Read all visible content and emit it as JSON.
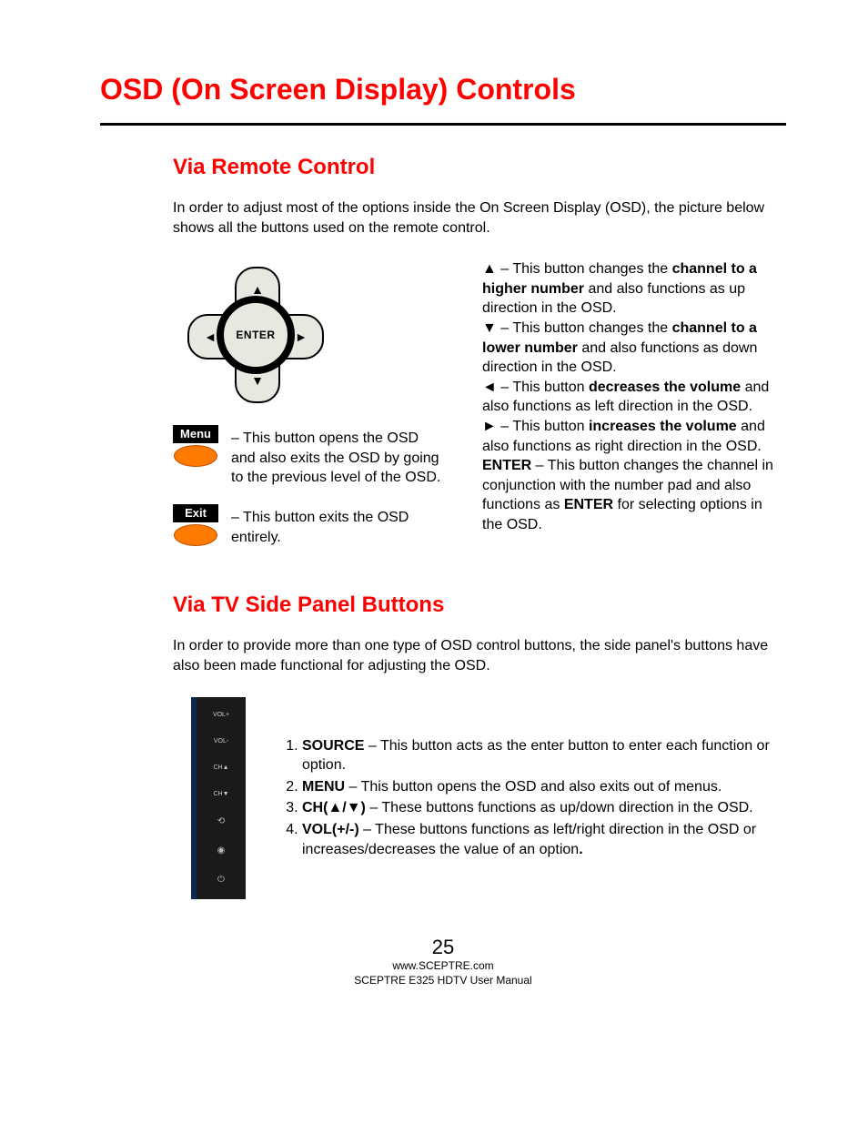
{
  "title": "OSD (On Screen Display) Controls",
  "section1": {
    "heading": "Via Remote Control",
    "intro": "In order to adjust most of the options inside the On Screen Display (OSD), the picture below shows all the buttons used on the remote control.",
    "dpad_enter": "ENTER",
    "menu_label": "Menu",
    "menu_desc": " – This button opens the OSD and also exits the OSD by going to the previous level of the OSD.",
    "exit_label": "Exit",
    "exit_desc": " – This button exits the OSD entirely.",
    "up_sym": "▲",
    "up_a": " – This button changes the ",
    "up_b": "channel to a higher number",
    "up_c": " and also functions as up direction in the OSD.",
    "down_sym": "▼",
    "down_a": " – This button changes the ",
    "down_b": "channel to a lower number",
    "down_c": " and also functions as down direction in the OSD.",
    "left_sym": "◄",
    "left_a": " – This button ",
    "left_b": "decreases the volume",
    "left_c": " and also functions as left direction in the OSD.",
    "right_sym": "►",
    "right_a": " – This button ",
    "right_b": "increases the volume",
    "right_c": " and also functions as right direction in the OSD.",
    "enter_lbl": "ENTER",
    "enter_a": " – This button changes the channel in conjunction with the number pad and also functions as ",
    "enter_b": "ENTER",
    "enter_c": " for selecting options in the OSD."
  },
  "section2": {
    "heading": "Via TV Side Panel Buttons",
    "intro": "In order to provide more than one type of OSD control buttons, the side panel's buttons have also been made functional for adjusting the OSD.",
    "panel": {
      "b1": "VOL+",
      "b2": "VOL-",
      "b3": "CH▲",
      "b4": "CH▼",
      "b5": "⟲",
      "b6": "◉",
      "b7": "⏻"
    },
    "list": {
      "i1a": "SOURCE",
      "i1b": " – This button acts as the enter button to enter each function or option.",
      "i2a": "MENU",
      "i2b": " – This button opens the OSD and also exits out of menus.",
      "i3a": "CH(▲/▼)",
      "i3b": " – These buttons functions as up/down direction in the OSD.",
      "i4a": "VOL(+/-)",
      "i4b": " – These buttons functions as left/right direction in the OSD or increases/decreases the value of an option",
      "i4c": "."
    }
  },
  "footer": {
    "page": "25",
    "url": "www.SCEPTRE.com",
    "manual": "SCEPTRE E325 HDTV User Manual"
  }
}
